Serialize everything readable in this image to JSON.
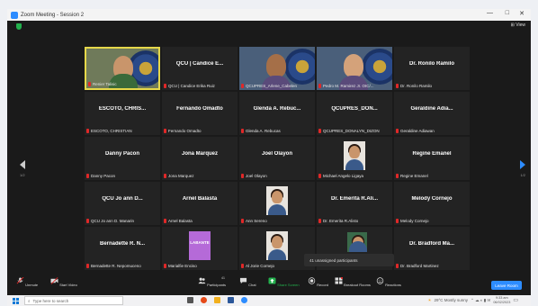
{
  "window": {
    "title": "Zoom Meeting - Session 2",
    "controls": [
      "—",
      "□",
      "✕"
    ],
    "view_label": "View"
  },
  "participants": [
    {
      "name": "",
      "label": "Renier Talisic",
      "video": true,
      "active": true
    },
    {
      "name": "QCU | Candice E...",
      "label": "QCU | Candice Erika Ruiz",
      "video": false
    },
    {
      "name": "",
      "label": "QCUPRES_Arlene_Cabelen",
      "video": true
    },
    {
      "name": "",
      "label": "Pedro M. Ramirez Jr. OIC/...",
      "video": true
    },
    {
      "name": "Dr. Ronilo Ramilo",
      "label": "Dr. Ronilo Ramilo",
      "video": false
    },
    {
      "name": "ESCOTO, CHRIS...",
      "label": "ESCOTO, CHRISTIAN",
      "video": false
    },
    {
      "name": "Fernando Omadto",
      "label": "Fernando Omadto",
      "video": false
    },
    {
      "name": "Glenda A. Rebuc...",
      "label": "Glenda A. Rebucas",
      "video": false
    },
    {
      "name": "QCUPRES_DON...",
      "label": "QCUPRES_DONALYN_DIZON",
      "video": false
    },
    {
      "name": "Geraldine Adia...",
      "label": "Geraldine Adiawan",
      "video": false
    },
    {
      "name": "Danny Pacon",
      "label": "Danny Pacon",
      "video": false
    },
    {
      "name": "Jona Marquez",
      "label": "Jona Marquez",
      "video": false
    },
    {
      "name": "Joel Olayon",
      "label": "Joel Olayon",
      "video": false
    },
    {
      "name": "",
      "label": "Michael Angelo Ligaya",
      "video": true,
      "photo": true
    },
    {
      "name": "Regine Emanel",
      "label": "Regine Emanel",
      "video": false
    },
    {
      "name": "QCU Jo ann D...",
      "label": "QCU Jo ann D. Manarin",
      "video": false
    },
    {
      "name": "Arnel Balasta",
      "label": "Arnel Balasta",
      "video": false
    },
    {
      "name": "",
      "label": "Ann Sereno",
      "video": true,
      "photo": true
    },
    {
      "name": "Dr. Emerita R.Ali...",
      "label": "Dr. Emerita R.Alisto",
      "video": false
    },
    {
      "name": "Melody Cornejo",
      "label": "Melody Cornejo",
      "video": false
    },
    {
      "name": "Bernadette R. N...",
      "label": "Bernadette R. Nepomuceno",
      "video": false
    },
    {
      "name": "",
      "label": "Marialfie Enciso",
      "video": true,
      "photo": true,
      "banner": "LABANTE"
    },
    {
      "name": "",
      "label": "Al Jorie Cornejo",
      "video": true,
      "photo": true
    },
    {
      "name": "",
      "label": "",
      "video": true,
      "photo": true
    },
    {
      "name": "Dr. Bradford Ma...",
      "label": "Dr. Bradford Martinez",
      "video": false
    }
  ],
  "page_indicator": "1/2",
  "unassigned_text": "41 unassigned participants",
  "toolbar": {
    "unmute": "Unmute",
    "start_video": "Start Video",
    "participants": "Participants",
    "participants_count": "41",
    "chat": "Chat",
    "share_screen": "Share Screen",
    "record": "Record",
    "breakout_rooms": "Breakout Rooms",
    "reactions": "Reactions",
    "leave": "Leave Room"
  },
  "taskbar": {
    "search_placeholder": "Type here to search",
    "weather": "29°C Mostly sunny",
    "time": "9:33 am",
    "date": "06/02/2023"
  },
  "colors": {
    "accent": "#2d8cff",
    "share_green": "#23b14d",
    "muted_red": "#e02828",
    "active_border": "#e6d84a"
  }
}
